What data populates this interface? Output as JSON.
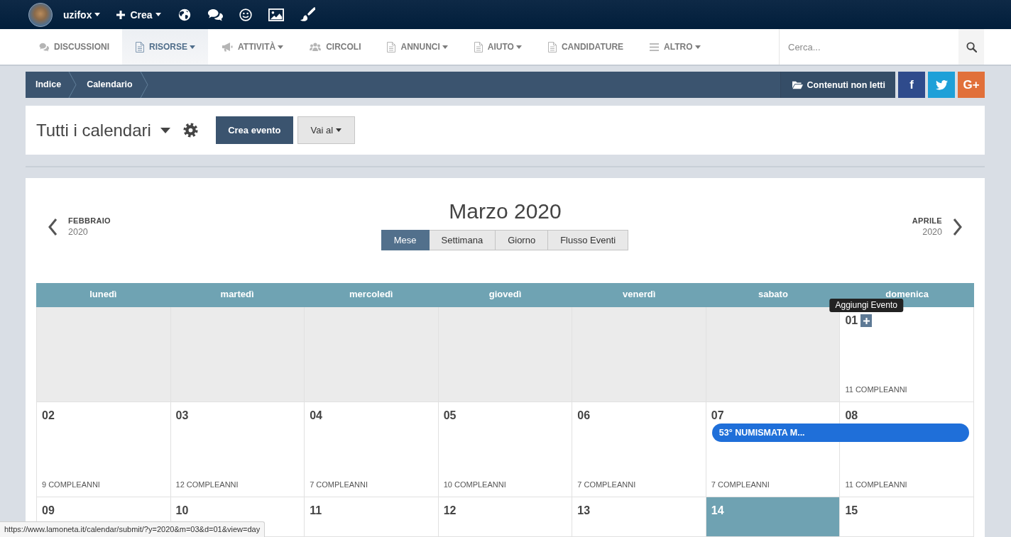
{
  "top_bar": {
    "user": {
      "name": "uzifox",
      "dropdown": true
    },
    "create": {
      "label": "Crea",
      "dropdown": true
    }
  },
  "nav": {
    "items": [
      {
        "label": "DISCUSSIONI",
        "selected": false,
        "dropdown": false
      },
      {
        "label": "RISORSE",
        "selected": true,
        "dropdown": true
      },
      {
        "label": "ATTIVITÀ",
        "selected": false,
        "dropdown": true
      },
      {
        "label": "CIRCOLI",
        "selected": false,
        "dropdown": false
      },
      {
        "label": "ANNUNCI",
        "selected": false,
        "dropdown": true
      },
      {
        "label": "AIUTO",
        "selected": false,
        "dropdown": true
      },
      {
        "label": "CANDIDATURE",
        "selected": false,
        "dropdown": false
      },
      {
        "label": "ALTRO",
        "selected": false,
        "dropdown": true
      }
    ],
    "search": {
      "placeholder": "Cerca..."
    }
  },
  "breadcrumb": {
    "items": [
      "Indice",
      "Calendario"
    ],
    "unread": "Contenuti non letti",
    "share": [
      {
        "kind": "text",
        "label": "f",
        "color": "#2f4b8c"
      },
      {
        "kind": "icon",
        "color": "#1ea0d8"
      },
      {
        "kind": "text",
        "label": "G+",
        "color": "#e1703a"
      }
    ]
  },
  "header": {
    "title": "Tutti i calendari",
    "dropdown": true,
    "create_button": "Crea evento",
    "goto": {
      "label": "Vai al",
      "dropdown": true
    }
  },
  "calendar": {
    "prev": {
      "month": "FEBBRAIO",
      "year": "2020"
    },
    "title": "Marzo 2020",
    "next": {
      "month": "APRILE",
      "year": "2020"
    },
    "views": [
      {
        "label": "Mese",
        "selected": true
      },
      {
        "label": "Settimana",
        "selected": false
      },
      {
        "label": "Giorno",
        "selected": false
      },
      {
        "label": "Flusso Eventi",
        "selected": false
      }
    ],
    "weekdays": [
      "lunedì",
      "martedì",
      "mercoledì",
      "giovedì",
      "venerdì",
      "sabato",
      "domenica"
    ],
    "weeks": [
      {
        "days": [
          {
            "outside": true,
            "today": false
          },
          {
            "outside": true,
            "today": false
          },
          {
            "outside": true,
            "today": false
          },
          {
            "outside": true,
            "today": false
          },
          {
            "outside": true,
            "today": false
          },
          {
            "outside": true,
            "today": false
          },
          {
            "day": "01",
            "outside": false,
            "today": false,
            "birthdays": "11 COMPLEANNI",
            "add_event": {
              "tooltip": "Aggiungi Evento"
            }
          }
        ]
      },
      {
        "days": [
          {
            "day": "02",
            "outside": false,
            "today": false,
            "birthdays": "9 COMPLEANNI"
          },
          {
            "day": "03",
            "outside": false,
            "today": false,
            "birthdays": "12 COMPLEANNI"
          },
          {
            "day": "04",
            "outside": false,
            "today": false,
            "birthdays": "7 COMPLEANNI"
          },
          {
            "day": "05",
            "outside": false,
            "today": false,
            "birthdays": "10 COMPLEANNI"
          },
          {
            "day": "06",
            "outside": false,
            "today": false,
            "birthdays": "7 COMPLEANNI"
          },
          {
            "day": "07",
            "outside": false,
            "today": false,
            "birthdays": "7 COMPLEANNI",
            "events": [
              {
                "title": "53° NUMISMATA M...",
                "continues": true
              }
            ]
          },
          {
            "day": "08",
            "outside": false,
            "today": false,
            "birthdays": "11 COMPLEANNI"
          }
        ]
      },
      {
        "days": [
          {
            "day": "09",
            "outside": false,
            "today": false
          },
          {
            "day": "10",
            "outside": false,
            "today": false
          },
          {
            "day": "11",
            "outside": false,
            "today": false
          },
          {
            "day": "12",
            "outside": false,
            "today": false
          },
          {
            "day": "13",
            "outside": false,
            "today": false
          },
          {
            "day": "14",
            "outside": false,
            "today": true
          },
          {
            "day": "15",
            "outside": false,
            "today": false
          }
        ]
      }
    ]
  },
  "status_bar": {
    "url": "https://www.lamoneta.it/calendar/submit/?y=2020&m=03&d=01&view=day"
  }
}
